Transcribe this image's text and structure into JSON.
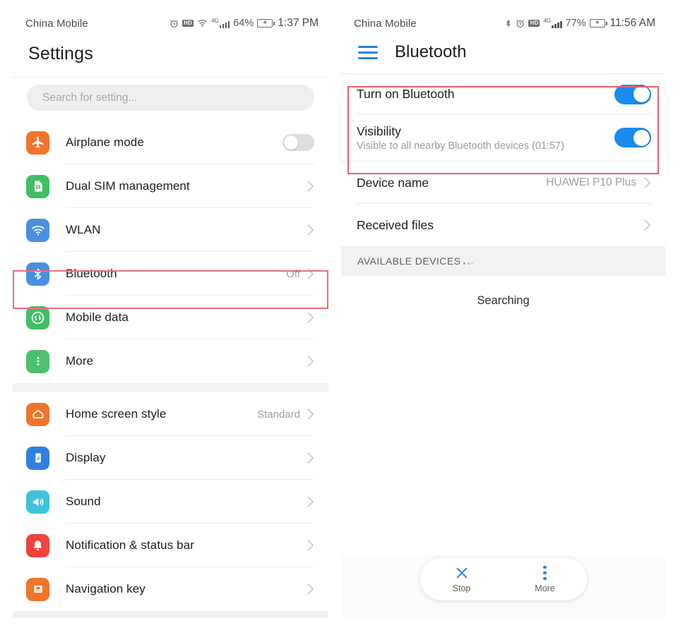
{
  "left_phone": {
    "status_bar": {
      "carrier": "China Mobile",
      "icons": [
        "alarm-icon",
        "hd-icon",
        "wifi-icon",
        "signal-4g-icon"
      ],
      "network_gen": "4G",
      "battery_percent": "64%",
      "time": "1:37 PM"
    },
    "header": {
      "title": "Settings"
    },
    "search": {
      "placeholder": "Search for setting..."
    },
    "groups": [
      {
        "items": [
          {
            "label": "Airplane mode",
            "icon": "airplane-icon",
            "icon_color": "#f2742a",
            "control": "toggle-off",
            "value": ""
          },
          {
            "label": "Dual SIM management",
            "icon": "sim-card-icon",
            "icon_color": "#3fc067",
            "control": "chevron",
            "value": ""
          },
          {
            "label": "WLAN",
            "icon": "wifi-icon",
            "icon_color": "#4a8fe0",
            "control": "chevron",
            "value": ""
          },
          {
            "label": "Bluetooth",
            "icon": "bluetooth-icon",
            "icon_color": "#4a8fe0",
            "control": "chevron",
            "value": "Off"
          },
          {
            "label": "Mobile data",
            "icon": "mobile-data-icon",
            "icon_color": "#3fc067",
            "control": "chevron",
            "value": ""
          },
          {
            "label": "More",
            "icon": "more-dots-icon",
            "icon_color": "#4cc16d",
            "control": "chevron",
            "value": ""
          }
        ]
      },
      {
        "items": [
          {
            "label": "Home screen style",
            "icon": "home-icon",
            "icon_color": "#f2742a",
            "control": "chevron",
            "value": "Standard"
          },
          {
            "label": "Display",
            "icon": "display-icon",
            "icon_color": "#2f7fe0",
            "control": "chevron",
            "value": ""
          },
          {
            "label": "Sound",
            "icon": "sound-icon",
            "icon_color": "#3fc3dd",
            "control": "chevron",
            "value": ""
          },
          {
            "label": "Notification & status bar",
            "icon": "bell-icon",
            "icon_color": "#f0433c",
            "control": "chevron",
            "value": ""
          },
          {
            "label": "Navigation key",
            "icon": "navigation-key-icon",
            "icon_color": "#f2742a",
            "control": "chevron",
            "value": ""
          }
        ]
      }
    ],
    "highlight": {
      "target": "Bluetooth",
      "color": "#e8707a"
    }
  },
  "right_phone": {
    "status_bar": {
      "carrier": "China Mobile",
      "icons": [
        "bluetooth-icon",
        "alarm-icon",
        "hd-icon",
        "signal-4g-icon"
      ],
      "network_gen": "4G",
      "battery_percent": "77%",
      "time": "11:56 AM"
    },
    "header": {
      "menu_icon": "hamburger-icon",
      "title": "Bluetooth"
    },
    "highlight": {
      "targets": [
        "Turn on Bluetooth",
        "Visibility"
      ],
      "color": "#ef5f68"
    },
    "toggles": [
      {
        "label": "Turn on Bluetooth",
        "sub": "",
        "state": "on"
      },
      {
        "label": "Visibility",
        "sub": "Visible to all nearby Bluetooth devices (01:57)",
        "state": "on"
      }
    ],
    "rows": [
      {
        "label": "Device name",
        "value": "HUAWEI P10 Plus",
        "control": "chevron"
      },
      {
        "label": "Received files",
        "value": "",
        "control": "chevron"
      }
    ],
    "available_section": {
      "label": "AVAILABLE DEVICES",
      "loading_dots": "..."
    },
    "status": {
      "text": "Searching"
    },
    "actions": [
      {
        "label": "Stop",
        "icon": "close-x-icon"
      },
      {
        "label": "More",
        "icon": "more-dots-icon"
      }
    ],
    "accent_color": "#2f7fe0"
  }
}
